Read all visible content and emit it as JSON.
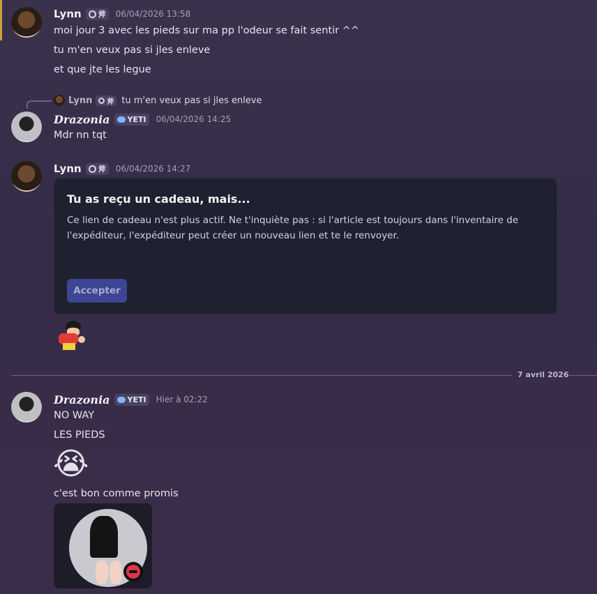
{
  "messages": [
    {
      "author": "Lynn",
      "tag": "斧",
      "timestamp": "06/04/2026 13:58",
      "lines": [
        "moi jour 3 avec les pieds sur ma pp l'odeur se fait sentir ^^",
        "tu m'en veux pas si jles enleve",
        "et que jte les legue"
      ]
    },
    {
      "reply": {
        "author": "Lynn",
        "tag": "斧",
        "text": "tu m'en veux pas si jles enleve"
      },
      "author": "Drazonia",
      "tag": "YETI",
      "timestamp": "06/04/2026 14:25",
      "lines": [
        "Mdr nn tqt"
      ]
    },
    {
      "author": "Lynn",
      "tag": "斧",
      "timestamp": "06/04/2026 14:27",
      "gift": {
        "title": "Tu as reçu un cadeau, mais...",
        "body_line1": "Ce lien de cadeau n'est plus actif. Ne t'inquiète pas : si l'article est toujours dans l'inventaire de",
        "body_line2": "l'expéditeur, l'expéditeur peut créer un nouveau lien et te le renvoyer.",
        "button": "Accepter"
      }
    },
    {
      "author": "Drazonia",
      "tag": "YETI",
      "timestamp": "Hier à 02:22",
      "lines": [
        "NO WAY",
        "LES PIEDS",
        "c'est bon comme promis"
      ],
      "emoji": "😭"
    }
  ],
  "divider": {
    "date": "7 avril 2026"
  },
  "colors": {
    "accent_button": "#3d4694",
    "background": "#3a324d",
    "card": "#1f2130"
  }
}
